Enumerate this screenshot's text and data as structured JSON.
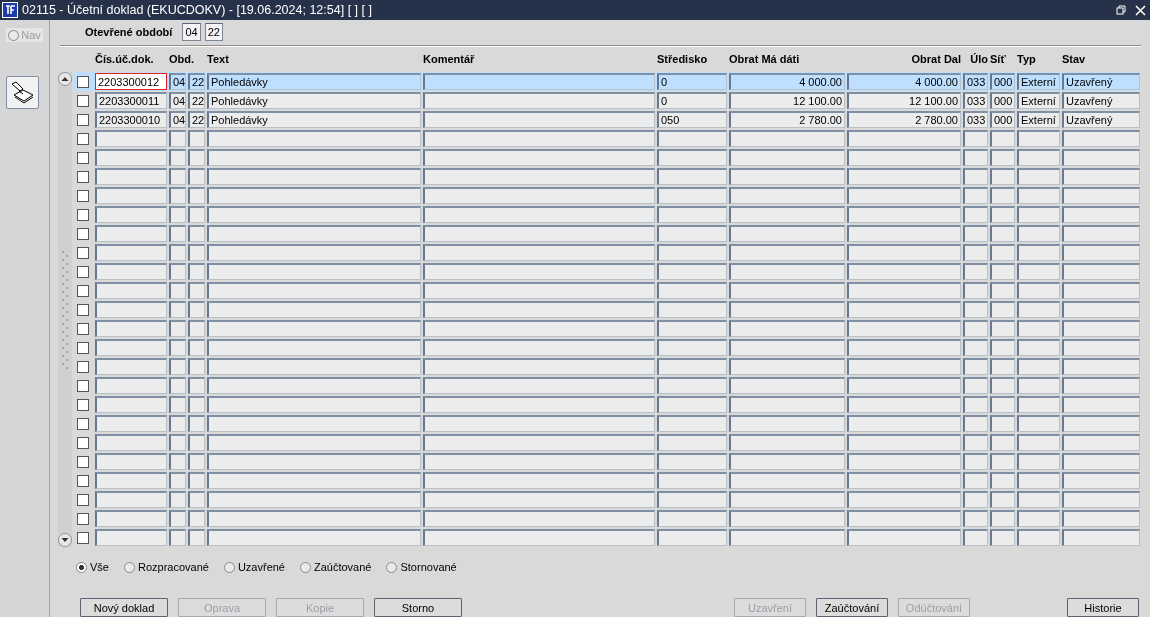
{
  "window": {
    "title": "02115 - Účetní doklad (EKUCDOKV) - [19.06.2024; 12:54] [ ] [ ]"
  },
  "sidebar": {
    "nav": {
      "label": "Nav",
      "selected": false
    }
  },
  "period": {
    "label": "Otevřené období",
    "month": "04",
    "year": "22"
  },
  "table": {
    "columns": [
      "Čís.úč.dok.",
      "Obd.",
      "Text",
      "Komentář",
      "Středisko",
      "Obrat Má dáti",
      "Obrat Dal",
      "Úlo",
      "Síť",
      "Typ",
      "Stav"
    ],
    "rows": [
      {
        "selected": true,
        "focused": true,
        "checked": false,
        "cells": [
          "2203300012",
          "04",
          "22",
          "Pohledávky",
          "",
          "0",
          "4 000.00",
          "4 000.00",
          "033",
          "000",
          "Externí",
          "Uzavřený"
        ]
      },
      {
        "selected": false,
        "focused": false,
        "checked": false,
        "cells": [
          "2203300011",
          "04",
          "22",
          "Pohledávky",
          "",
          "0",
          "12 100.00",
          "12 100.00",
          "033",
          "000",
          "Externí",
          "Uzavřený"
        ]
      },
      {
        "selected": false,
        "focused": false,
        "checked": false,
        "cells": [
          "2203300010",
          "04",
          "22",
          "Pohledávky",
          "",
          "050",
          "2 780.00",
          "2 780.00",
          "033",
          "000",
          "Externí",
          "Uzavřený"
        ]
      },
      {
        "selected": false,
        "focused": false,
        "checked": false
      },
      {
        "selected": false,
        "focused": false,
        "checked": false
      },
      {
        "selected": false,
        "focused": false,
        "checked": false
      },
      {
        "selected": false,
        "focused": false,
        "checked": false
      },
      {
        "selected": false,
        "focused": false,
        "checked": false
      },
      {
        "selected": false,
        "focused": false,
        "checked": false
      },
      {
        "selected": false,
        "focused": false,
        "checked": false
      },
      {
        "selected": false,
        "focused": false,
        "checked": false
      },
      {
        "selected": false,
        "focused": false,
        "checked": false
      },
      {
        "selected": false,
        "focused": false,
        "checked": false
      },
      {
        "selected": false,
        "focused": false,
        "checked": false
      },
      {
        "selected": false,
        "focused": false,
        "checked": false
      },
      {
        "selected": false,
        "focused": false,
        "checked": false
      },
      {
        "selected": false,
        "focused": false,
        "checked": false
      },
      {
        "selected": false,
        "focused": false,
        "checked": false
      },
      {
        "selected": false,
        "focused": false,
        "checked": false
      },
      {
        "selected": false,
        "focused": false,
        "checked": false
      },
      {
        "selected": false,
        "focused": false,
        "checked": false
      },
      {
        "selected": false,
        "focused": false,
        "checked": false
      },
      {
        "selected": false,
        "focused": false,
        "checked": false
      },
      {
        "selected": false,
        "focused": false,
        "checked": false
      },
      {
        "selected": false,
        "focused": false,
        "checked": false
      }
    ]
  },
  "filters": [
    {
      "label": "Vše",
      "selected": true
    },
    {
      "label": "Rozpracované",
      "selected": false
    },
    {
      "label": "Uzavřené",
      "selected": false
    },
    {
      "label": "Zaúčtované",
      "selected": false
    },
    {
      "label": "Stornované",
      "selected": false
    }
  ],
  "button_groups": [
    {
      "buttons": [
        {
          "label": "Nový doklad",
          "disabled": false
        },
        {
          "label": "Oprava",
          "disabled": true
        },
        {
          "label": "Kopie",
          "disabled": true
        },
        {
          "label": "Storno",
          "disabled": false
        }
      ]
    },
    {
      "buttons": [
        {
          "label": "Uzavření",
          "disabled": true
        },
        {
          "label": "Zaúčtování",
          "disabled": false
        },
        {
          "label": "Odúčtování",
          "disabled": true
        }
      ]
    },
    {
      "buttons": [
        {
          "label": "Historie",
          "disabled": false
        }
      ]
    }
  ]
}
